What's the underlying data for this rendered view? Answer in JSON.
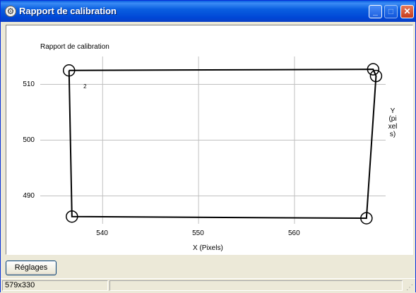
{
  "window": {
    "title": "Rapport de calibration",
    "icon": "gear-icon",
    "controls": {
      "minimize": "minimize-icon",
      "maximize": "maximize-icon",
      "close": "close-icon"
    }
  },
  "chart_data": {
    "type": "line",
    "title": "Rapport de calibration",
    "xlabel": "X (Pixels)",
    "ylabel": "Y (pixels)",
    "xlim": [
      533.5,
      569.5
    ],
    "ylim": [
      485,
      515
    ],
    "x_ticks": [
      540,
      550,
      560
    ],
    "y_ticks": [
      490,
      500,
      510
    ],
    "grid": true,
    "series": [
      {
        "type": "polyline-closed",
        "points": [
          {
            "x": 536.5,
            "y": 512.5
          },
          {
            "x": 568.2,
            "y": 512.7
          },
          {
            "x": 568.5,
            "y": 511.5
          },
          {
            "x": 567.5,
            "y": 486
          },
          {
            "x": 536.8,
            "y": 486.3
          },
          {
            "x": 536.5,
            "y": 512.5
          }
        ]
      }
    ],
    "markers": [
      {
        "x": 536.5,
        "y": 512.5
      },
      {
        "x": 568.2,
        "y": 512.7
      },
      {
        "x": 568.5,
        "y": 511.5
      },
      {
        "x": 567.5,
        "y": 486
      },
      {
        "x": 536.8,
        "y": 486.3
      }
    ],
    "point_labels": [
      {
        "text": "2",
        "x": 538.0,
        "y": 509.5
      }
    ]
  },
  "buttons": {
    "settings_label": "Réglages"
  },
  "status": {
    "size_text": "579x330"
  }
}
